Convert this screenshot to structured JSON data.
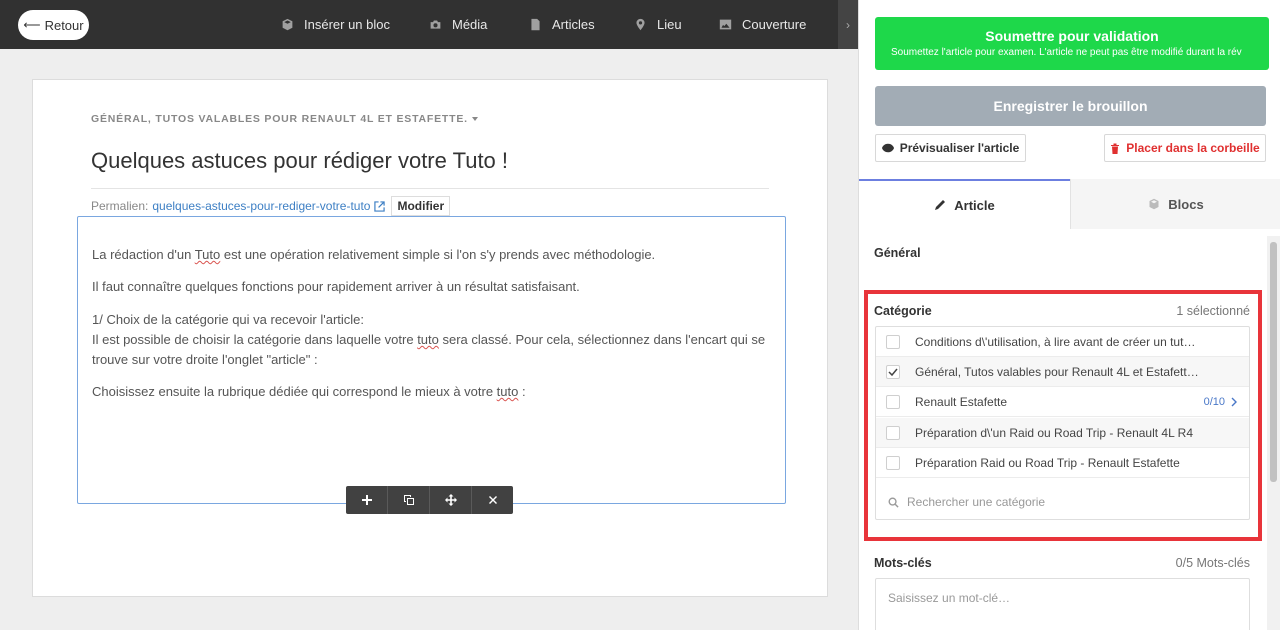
{
  "toolbar": {
    "back_label": "Retour",
    "items": [
      {
        "label": "Insérer un bloc",
        "icon": "cube-icon"
      },
      {
        "label": "Média",
        "icon": "camera-icon"
      },
      {
        "label": "Articles",
        "icon": "document-icon"
      },
      {
        "label": "Lieu",
        "icon": "map-pin-icon"
      },
      {
        "label": "Couverture",
        "icon": "image-icon"
      }
    ],
    "scroll_glyph": "›"
  },
  "article": {
    "breadcrumb": "GÉNÉRAL, TUTOS VALABLES POUR RENAULT 4L ET ESTAFETTE.",
    "title": "Quelques astuces pour rédiger votre Tuto !",
    "permalink_label": "Permalien:",
    "permalink_slug": "quelques-astuces-pour-rediger-votre-tuto",
    "modify_label": "Modifier",
    "para1_a": "La rédaction d'un ",
    "para1_b": "Tuto",
    "para1_c": " est une opération relativement simple si l'on s'y prends avec méthodologie.",
    "para2": "Il faut connaître quelques fonctions pour rapidement arriver à un résultat satisfaisant.",
    "para3_line1": "1/ Choix de la catégorie qui va recevoir l'article:",
    "para3_a": "Il est possible de choisir la catégorie dans laquelle votre ",
    "para3_b": "tuto",
    "para3_c": " sera classé. Pour cela, sélectionnez dans l'encart qui se trouve sur votre droite l'onglet \"article\" :",
    "para4_a": "Choisissez ensuite la rubrique dédiée qui correspond le mieux à votre ",
    "para4_b": "tuto",
    "para4_c": " :"
  },
  "panel": {
    "submit_label": "Soumettre pour validation",
    "submit_sub": "Soumettez l'article pour examen. L'article ne peut pas être modifié durant la rév",
    "draft_label": "Enregistrer le brouillon",
    "preview_label": "Prévisualiser l'article",
    "trash_label": "Placer dans la corbeille",
    "tab_article": "Article",
    "tab_blocks": "Blocs",
    "general_label": "Général",
    "category_label": "Catégorie",
    "category_count": "1 sélectionné",
    "categories": [
      {
        "label": "Conditions d\\'utilisation, à lire avant de créer un tut…",
        "checked": false
      },
      {
        "label": "Général, Tutos valables pour Renault 4L et Estafett…",
        "checked": true
      },
      {
        "label": "Renault Estafette",
        "checked": false,
        "sub": "0/10"
      },
      {
        "label": "Préparation d\\'un Raid ou Road Trip - Renault 4L R4",
        "checked": false
      },
      {
        "label": "Préparation Raid ou Road Trip - Renault Estafette",
        "checked": false
      }
    ],
    "category_search_placeholder": "Rechercher une catégorie",
    "keywords_label": "Mots-clés",
    "keywords_count": "0/5 Mots-clés",
    "keywords_placeholder": "Saisissez un mot-clé…"
  },
  "colors": {
    "submit_green": "#1ed84a",
    "draft_gray": "#a2acb5",
    "trash_red": "#e03030",
    "highlight_red": "#e8343a",
    "link_blue": "#3d7fc4",
    "toolbar_dark": "#313131"
  }
}
